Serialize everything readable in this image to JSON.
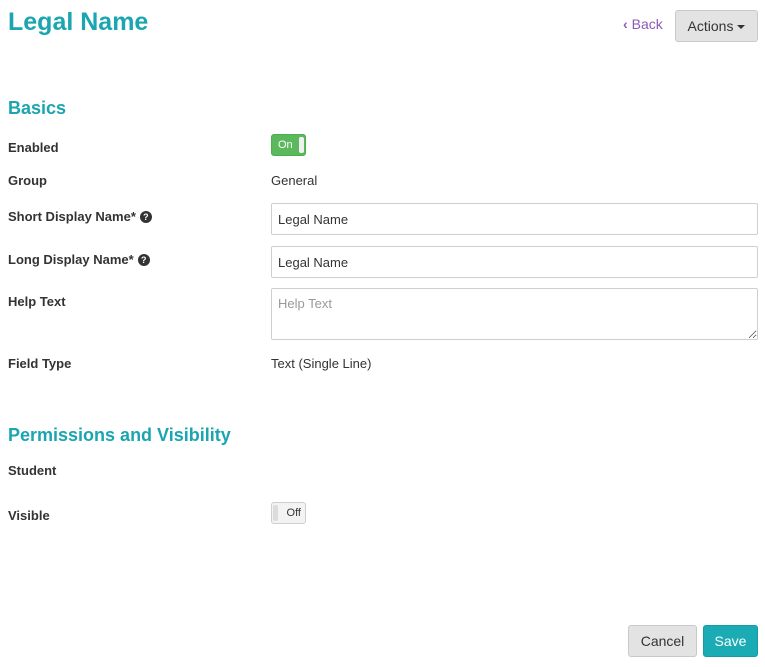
{
  "header": {
    "title": "Legal Name",
    "back_label": "Back",
    "actions_label": "Actions"
  },
  "basics": {
    "section_title": "Basics",
    "enabled_label": "Enabled",
    "enabled_toggle": "On",
    "group_label": "Group",
    "group_value": "General",
    "short_display_label": "Short Display Name*",
    "short_display_value": "Legal Name",
    "long_display_label": "Long Display Name*",
    "long_display_value": "Legal Name",
    "help_text_label": "Help Text",
    "help_text_placeholder": "Help Text",
    "field_type_label": "Field Type",
    "field_type_value": "Text (Single Line)"
  },
  "permissions": {
    "section_title": "Permissions and Visibility",
    "student_label": "Student",
    "visible_label": "Visible",
    "visible_toggle": "Off"
  },
  "footer": {
    "cancel_label": "Cancel",
    "save_label": "Save"
  },
  "colors": {
    "accent": "#1aa5b0",
    "link": "#8b5bb8",
    "toggle_on": "#5cb85c",
    "save_button": "#1aabb5"
  }
}
